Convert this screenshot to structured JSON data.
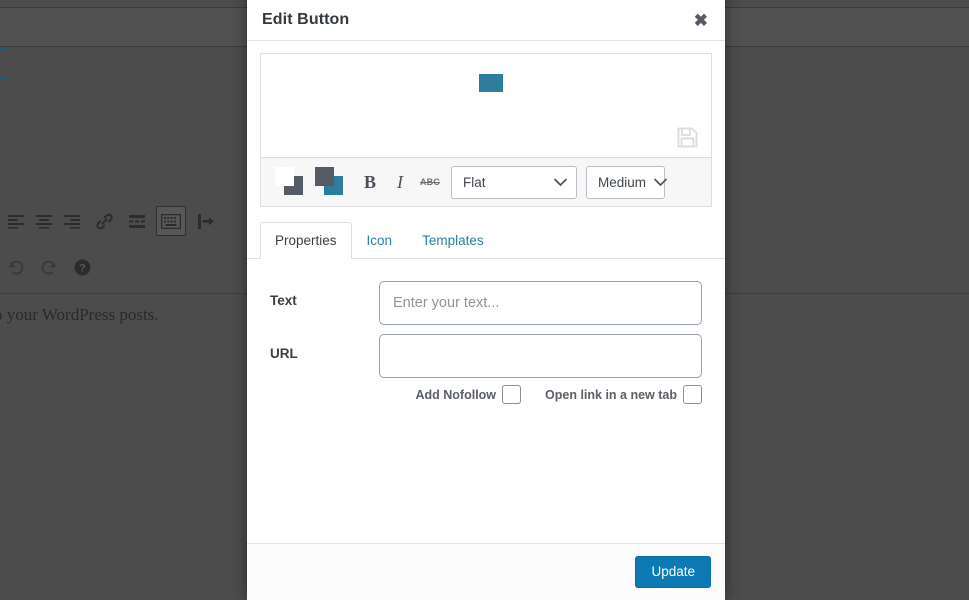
{
  "background": {
    "editor_text": "o your WordPress posts.",
    "toolbar_row1": [
      {
        "name": "align-left-icon"
      },
      {
        "name": "align-center-icon"
      },
      {
        "name": "align-right-icon"
      },
      {
        "name": "link-icon"
      },
      {
        "name": "read-more-icon"
      },
      {
        "name": "keyboard-shortcuts-icon"
      },
      {
        "name": "distraction-free-icon"
      }
    ],
    "toolbar_row2": [
      {
        "name": "undo-icon"
      },
      {
        "name": "redo-icon"
      },
      {
        "name": "help-icon"
      }
    ]
  },
  "modal": {
    "title": "Edit Button",
    "close_label": "✖",
    "preview": {
      "button_color": "#2d7d9e",
      "save_icon": "save-icon"
    },
    "toolbar": {
      "text_color_swatch": {
        "front": "#ffffff",
        "back": "#555c66"
      },
      "background_color_swatch": {
        "front": "#555c66",
        "back": "#2d7d9e"
      },
      "bold_label": "B",
      "italic_label": "I",
      "strikethrough_label": "ABC",
      "style_select": "Flat",
      "size_select": "Medium"
    },
    "tabs": [
      {
        "id": "properties",
        "label": "Properties",
        "active": true
      },
      {
        "id": "icon",
        "label": "Icon",
        "active": false
      },
      {
        "id": "templates",
        "label": "Templates",
        "active": false
      }
    ],
    "form": {
      "text_label": "Text",
      "text_value": "",
      "text_placeholder": "Enter your text...",
      "url_label": "URL",
      "url_value": "",
      "url_placeholder": "",
      "nofollow_label": "Add Nofollow",
      "newtab_label": "Open link in a new tab"
    },
    "footer": {
      "update_label": "Update"
    }
  },
  "colors": {
    "accent": "#2d7d9e",
    "primary_button": "#0d7ab5",
    "tab_link": "#2e7da3",
    "backdrop": "#4c4c4c"
  }
}
